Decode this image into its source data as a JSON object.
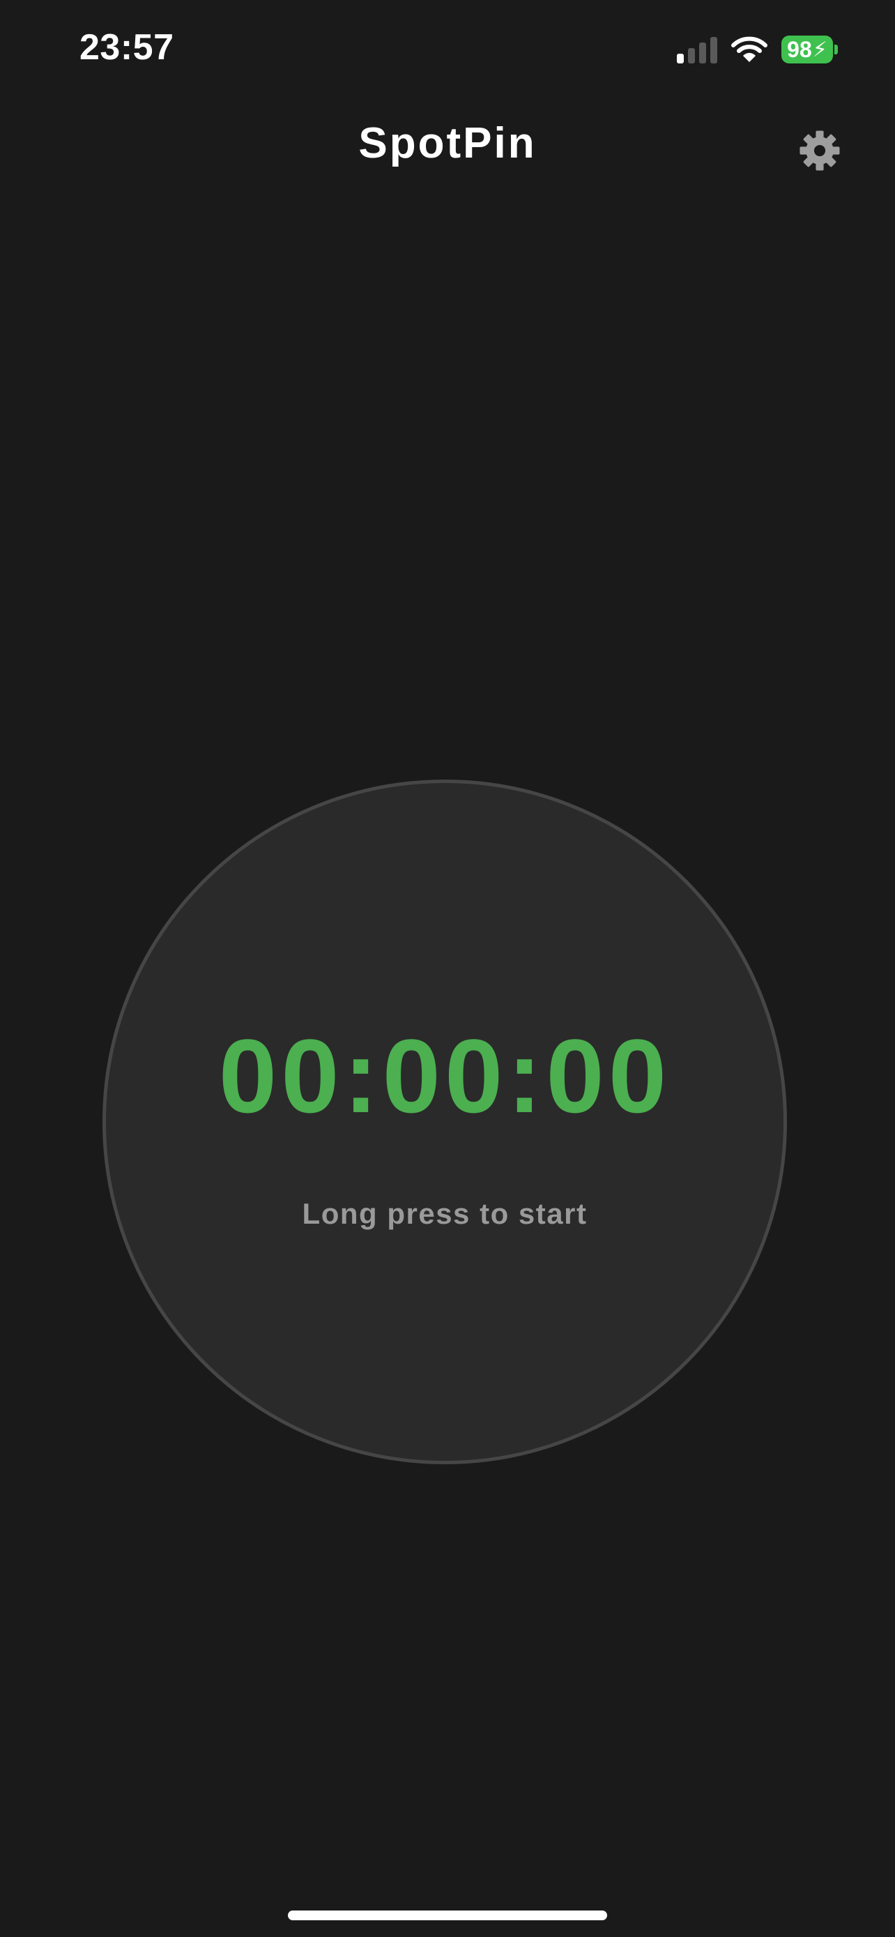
{
  "status_bar": {
    "time": "23:57",
    "signal_icon": "cellular-signal-icon",
    "wifi_icon": "wifi-icon",
    "battery_percent": "98",
    "battery_charging_glyph": "⚡",
    "battery_color": "#3fc14f"
  },
  "nav": {
    "title": "SpotPin",
    "settings_icon": "gear-icon"
  },
  "timer": {
    "display": "00:00:00",
    "hint": "Long press to start",
    "accent_color": "#4caf50"
  }
}
